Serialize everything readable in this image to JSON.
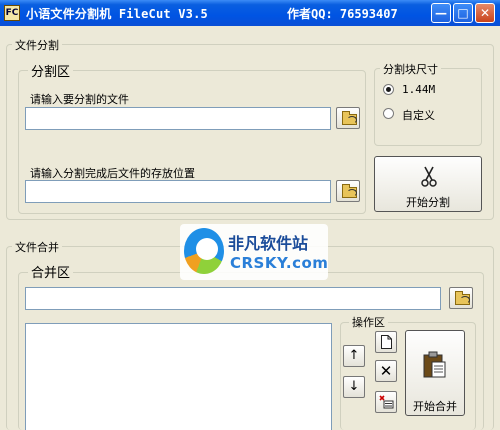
{
  "window": {
    "app_icon": "FC",
    "title": "小语文件分割机 FileCut V3.5",
    "author": "作者QQ: 76593407",
    "min_glyph": "—",
    "max_glyph": "□",
    "close_glyph": "✕"
  },
  "split_section": {
    "group_label": "文件分割",
    "area_label": "分割区",
    "source_label": "请输入要分割的文件",
    "source_value": "",
    "dest_label": "请输入分割完成后文件的存放位置",
    "dest_value": "",
    "chunk_group_label": "分割块尺寸",
    "chunk_options": [
      "1.44M",
      "自定义"
    ],
    "chunk_selected": "1.44M",
    "split_button_label": "开始分割"
  },
  "merge_section": {
    "group_label": "文件合并",
    "area_label": "合并区",
    "merge_path_value": "",
    "ops_label": "操作区",
    "up_glyph": "↑",
    "down_glyph": "↓",
    "delete_glyph": "✕",
    "merge_button_label": "开始合并"
  },
  "watermark": {
    "cn": "非凡软件站",
    "en": "CRSKY.com"
  },
  "icons": [
    "app-icon",
    "minimize-icon",
    "maximize-icon",
    "close-icon",
    "folder-open-icon",
    "scissors-icon",
    "new-file-icon",
    "delete-icon",
    "clear-list-icon",
    "clipboard-icon",
    "up-arrow-icon",
    "down-arrow-icon"
  ]
}
